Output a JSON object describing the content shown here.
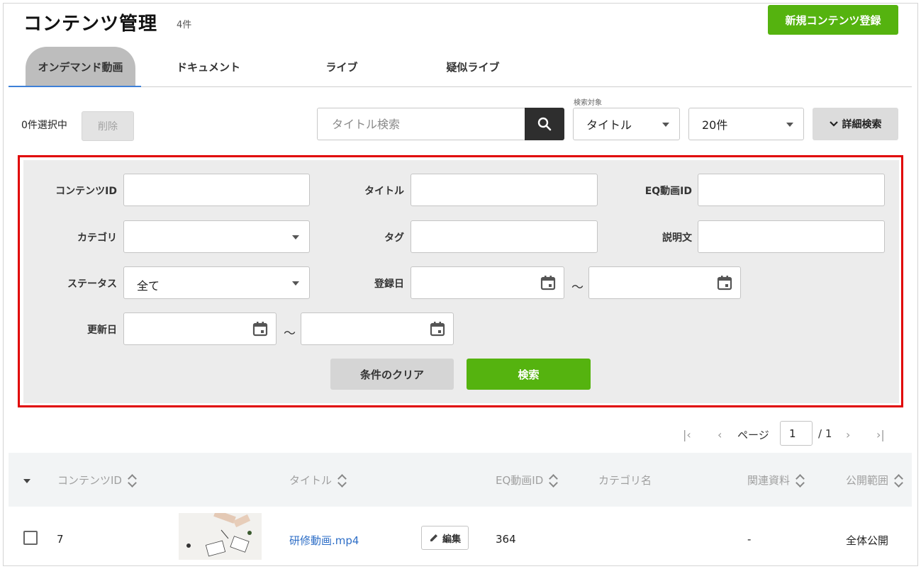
{
  "header": {
    "title": "コンテンツ管理",
    "count": "4件",
    "new_button": "新規コンテンツ登録"
  },
  "tabs": [
    {
      "label": "オンデマンド動画",
      "active": true
    },
    {
      "label": "ドキュメント",
      "active": false
    },
    {
      "label": "ライブ",
      "active": false
    },
    {
      "label": "疑似ライブ",
      "active": false
    }
  ],
  "toolbar": {
    "selected_count": "0件選択中",
    "delete_label": "削除",
    "search_placeholder": "タイトル検索",
    "search_target_label": "検索対象",
    "search_target_value": "タイトル",
    "per_page_value": "20件",
    "detail_search_label": "詳細検索"
  },
  "filters": {
    "content_id_label": "コンテンツID",
    "title_label": "タイトル",
    "eq_video_id_label": "EQ動画ID",
    "category_label": "カテゴリ",
    "tag_label": "タグ",
    "description_label": "説明文",
    "status_label": "ステータス",
    "status_value": "全て",
    "registered_date_label": "登録日",
    "updated_date_label": "更新日",
    "range_separator": "～",
    "clear_button": "条件のクリア",
    "search_button": "検索"
  },
  "pagination": {
    "page_label": "ページ",
    "current_page": "1",
    "total_pages": "/ 1"
  },
  "table": {
    "headers": [
      "コンテンツID",
      "タイトル",
      "EQ動画ID",
      "カテゴリ名",
      "関連資料",
      "公開範囲"
    ],
    "rows": [
      {
        "content_id": "7",
        "title": "研修動画.mp4",
        "edit_label": "編集",
        "eq_video_id": "364",
        "category": "",
        "related": "-",
        "visibility": "全体公開"
      }
    ]
  },
  "colors": {
    "accent_green": "#55b30f",
    "highlight_red": "#e00000",
    "tab_underline_blue": "#3d80d8",
    "link_blue": "#2f6fc7"
  }
}
